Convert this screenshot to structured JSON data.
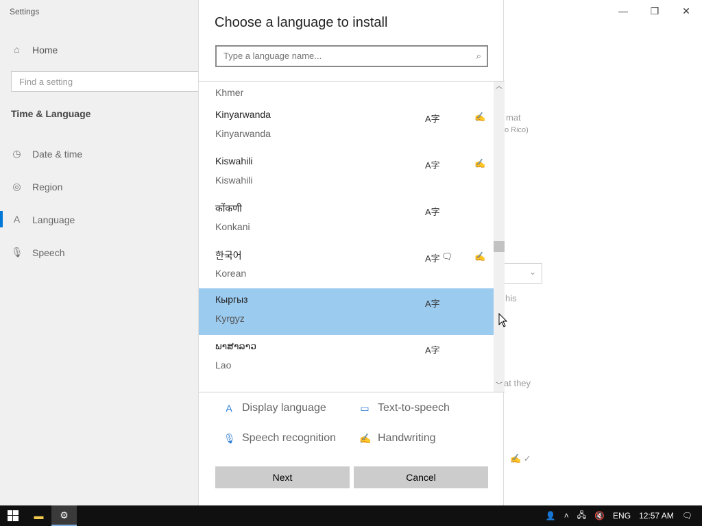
{
  "settings": {
    "app_title": "Settings",
    "home": "Home",
    "search_placeholder": "Find a setting",
    "section": "Time & Language",
    "nav": [
      {
        "label": "Date & time",
        "icon": "calendar-clock-icon"
      },
      {
        "label": "Region",
        "icon": "globe-icon"
      },
      {
        "label": "Language",
        "icon": "language-icon",
        "active": true
      },
      {
        "label": "Speech",
        "icon": "microphone-icon"
      }
    ],
    "bg_fragments": {
      "format": "mat",
      "region": "o Rico)",
      "this": "his",
      "they": "at they"
    }
  },
  "dialog": {
    "title": "Choose a language to install",
    "search_placeholder": "Type a language name...",
    "languages": [
      {
        "native": "Khmer",
        "english": "",
        "display": false,
        "tts": false,
        "handwriting": false
      },
      {
        "native": "Kinyarwanda",
        "english": "Kinyarwanda",
        "display": true,
        "tts": false,
        "handwriting": true
      },
      {
        "native": "Kiswahili",
        "english": "Kiswahili",
        "display": true,
        "tts": false,
        "handwriting": true
      },
      {
        "native": "कोंकणी",
        "english": "Konkani",
        "display": true,
        "tts": false,
        "handwriting": false
      },
      {
        "native": "한국어",
        "english": "Korean",
        "display": true,
        "tts": true,
        "handwriting": true
      },
      {
        "native": "Кыргыз",
        "english": "Kyrgyz",
        "display": true,
        "tts": false,
        "handwriting": false,
        "selected": true
      },
      {
        "native": "ພາສາລາວ",
        "english": "Lao",
        "display": true,
        "tts": false,
        "handwriting": false
      }
    ],
    "legend": {
      "display_language": "Display language",
      "text_to_speech": "Text-to-speech",
      "speech_recognition": "Speech recognition",
      "handwriting": "Handwriting"
    },
    "next_label": "Next",
    "cancel_label": "Cancel"
  },
  "taskbar": {
    "input_lang": "ENG",
    "time": "12:57 AM"
  },
  "colors": {
    "selected_row": "#9ccbf0",
    "accent": "#0078d7",
    "button": "#cccccc"
  }
}
